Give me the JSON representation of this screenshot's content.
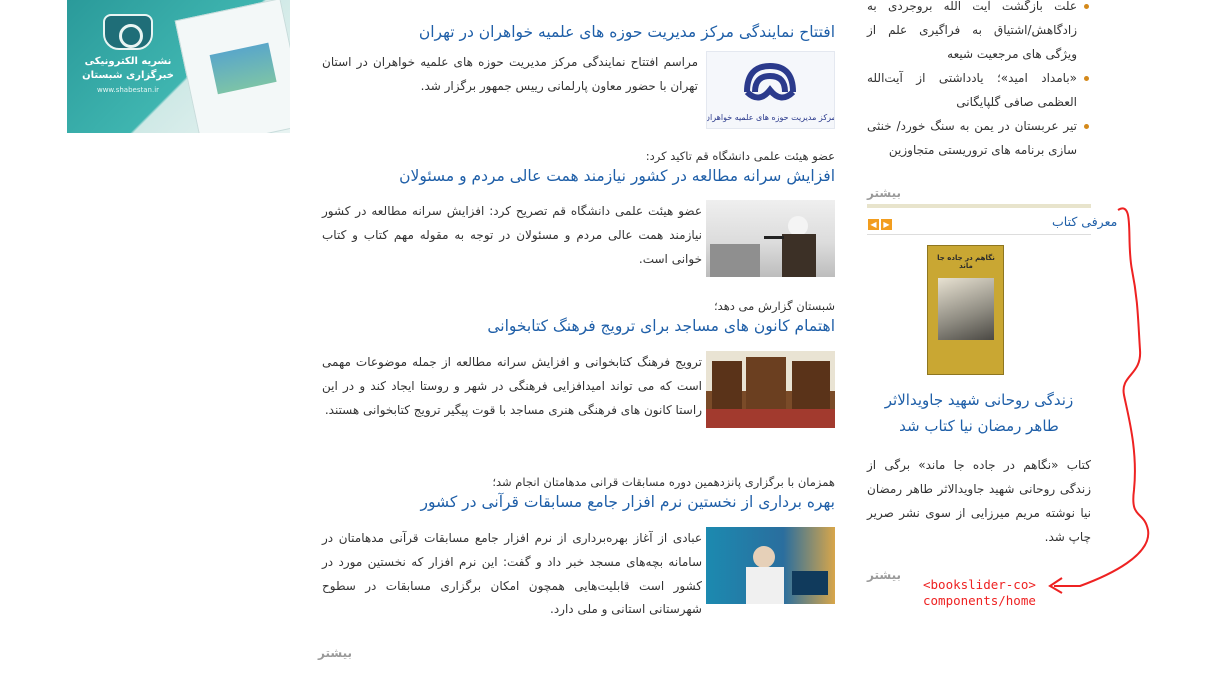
{
  "banner": {
    "line1": "نشریه الکترونیکی",
    "line2": "خبرگزاری شبستان",
    "url": "www.shabestan.ir"
  },
  "news": [
    {
      "lead": "",
      "title": "افتتاح نمایندگی مرکز مدیریت حوزه های علمیه خواهران در تهران",
      "body": "مراسم افتتاح نمایندگی مرکز مدیریت حوزه های علمیه خواهران در استان تهران با حضور معاون پارلمانی رییس جمهور برگزار شد.",
      "thumb_caption": "مرکز مدیریت حوزه های علمیه خواهران"
    },
    {
      "lead": "عضو هیئت علمی دانشگاه قم تاکید کرد:",
      "title": "افزایش سرانه مطالعه در کشور نیازمند همت عالی مردم و مسئولان",
      "body": "عضو هیئت علمی دانشگاه قم تصریح کرد: افزایش سرانه مطالعه در کشور نیازمند همت عالی مردم و مسئولان در توجه به مقوله مهم کتاب و کتاب خوانی است."
    },
    {
      "lead": "شبستان گزارش می دهد؛",
      "title": "اهتمام کانون های مساجد برای ترویج فرهنگ کتابخوانی",
      "body": "ترویج فرهنگ کتابخوانی و افزایش سرانه مطالعه از جمله موضوعات مهمی است که می تواند امیدافزایی فرهنگی در شهر و روستا ایجاد کند و در این راستا کانون های فرهنگی هنری مساجد با قوت پیگیر ترویج کتابخوانی هستند."
    },
    {
      "lead": "همزمان با برگزاری پانزدهمین دوره مسابقات قرانی مدهامتان انجام شد؛",
      "title": "بهره برداری از نخستین نرم افزار جامع مسابقات قرآنی در کشور",
      "body": "عبادی از آغاز بهره‌برداری از نرم افزار جامع مسابقات قرآنی مدهامتان در سامانه بچه‌های مسجد خبر داد و گفت: این نرم افزار که نخستین مورد در کشور است قابلیت‌هایی همچون امکان برگزاری مسابقات در سطوح شهرستانی استانی و ملی دارد."
    }
  ],
  "more_label": "بیشتر",
  "sidebar": {
    "bullets": [
      "علت بازگشت آیت الله بروجردی به زادگاهش/اشتیاق به فراگیری علم از ویژگی های مرجعیت شیعه",
      "«بامداد امید»؛ یادداشتی از آیت‌الله العظمی صافی گلپایگانی",
      "تیر عربستان در یمن به سنگ خورد/ خنثی سازی برنامه های تروریستی متجاوزین"
    ],
    "more_label": "بیشتر",
    "section_title": "معرفی کتاب",
    "book": {
      "cover_title": "نگاهم در جاده جا ماند",
      "name": "زندگی روحانی شهید جاویدالاثر طاهر رمضان نیا کتاب شد",
      "description": "کتاب «نگاهم در جاده جا ماند» برگی از زندگی روحانی شهید جاویدالاثر طاهر رمضان نیا نوشته مریم میرزایی از سوی نشر صریر چاپ شد."
    },
    "more_label_2": "بیشتر"
  },
  "annotation": {
    "line1": "<bookslider-co>",
    "line2": "components/home"
  },
  "colors": {
    "link": "#1f5fa8",
    "bullet": "#d4891b",
    "arrow": "#f29d1e",
    "annotation": "#ee2222"
  }
}
